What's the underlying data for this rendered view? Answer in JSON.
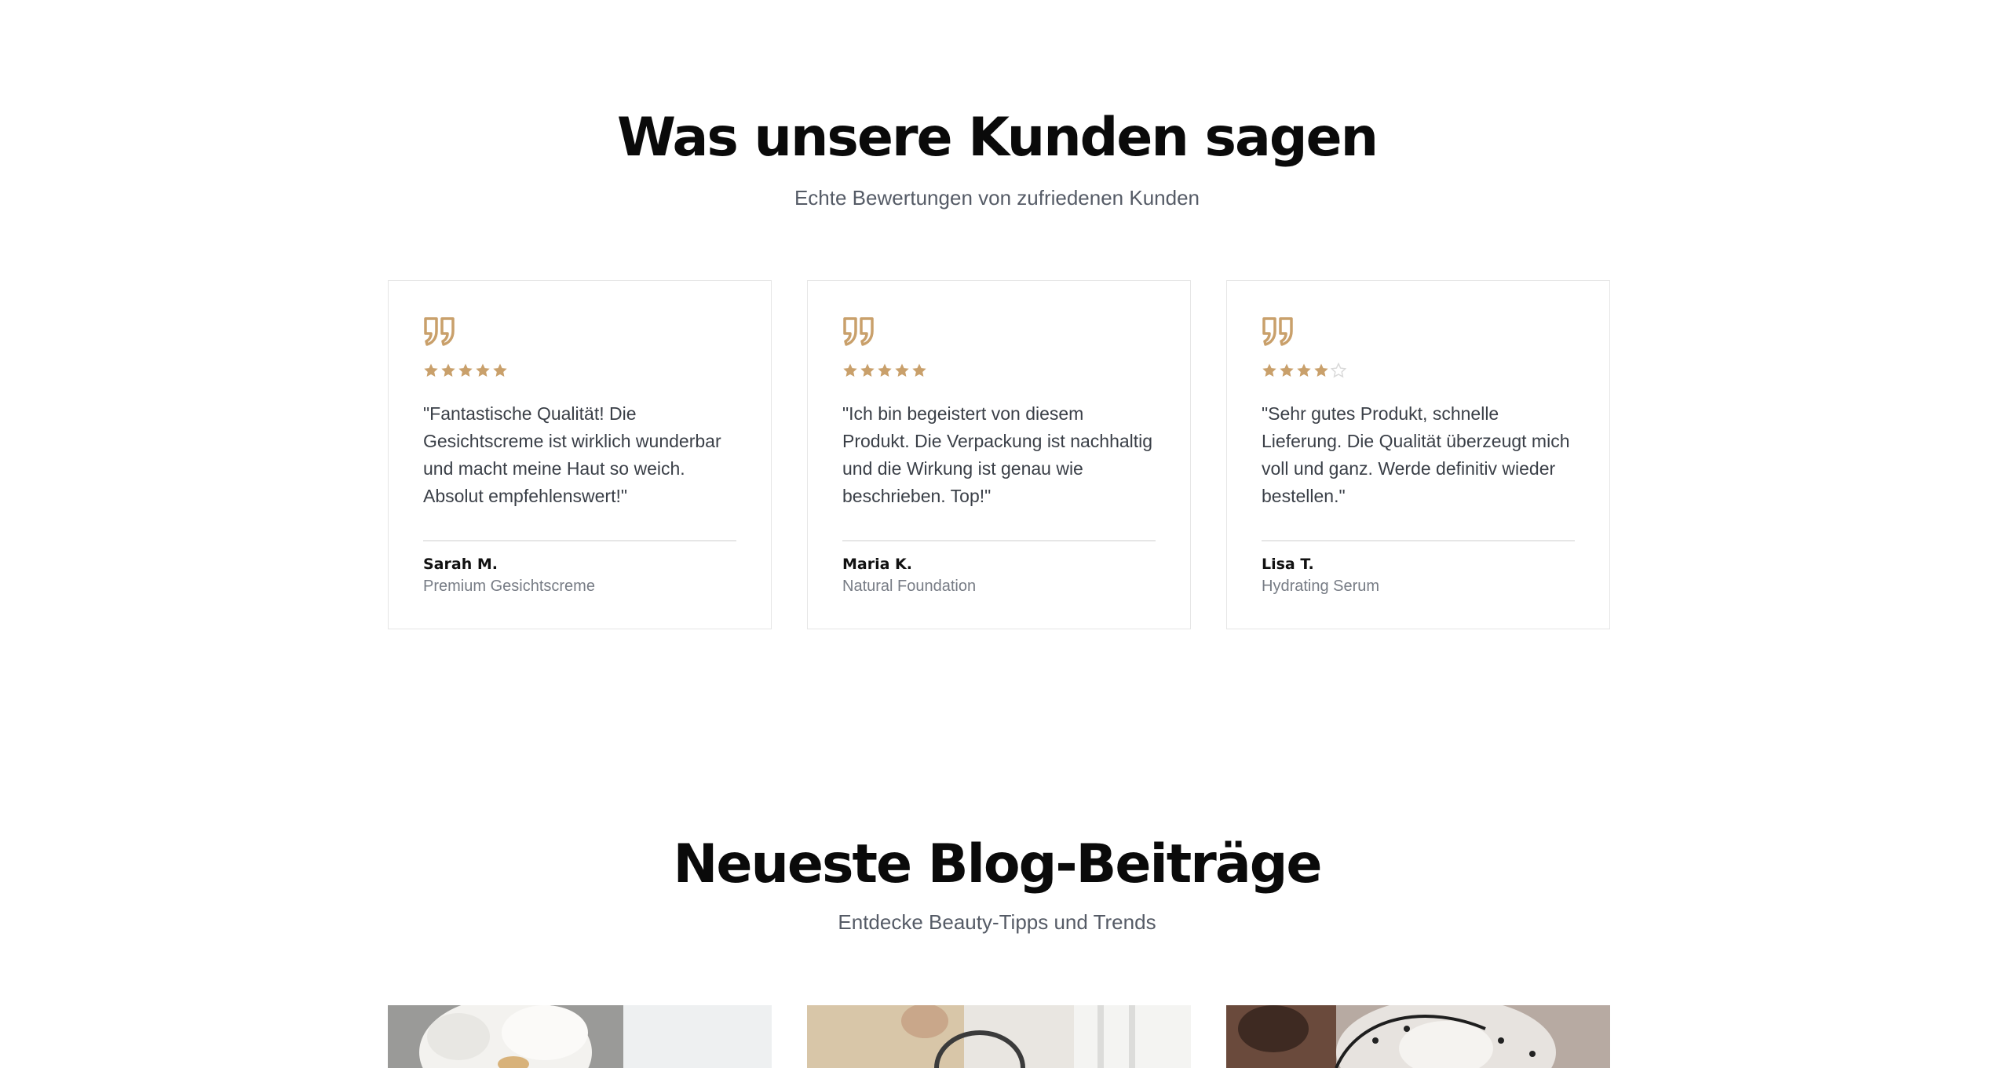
{
  "testimonials": {
    "title": "Was unsere Kunden sagen",
    "subtitle": "Echte Bewertungen von zufriedenen Kunden",
    "accent_color": "#c9a06b",
    "empty_star_color": "#d9d9d9",
    "items": [
      {
        "rating": 5,
        "text": "\"Fantastische Qualität! Die Gesichtscreme ist wirklich wunderbar und macht meine Haut so weich. Absolut empfehlenswert!\"",
        "author": "Sarah M.",
        "product": "Premium Gesichtscreme"
      },
      {
        "rating": 5,
        "text": "\"Ich bin begeistert von diesem Produkt. Die Verpackung ist nachhaltig und die Wirkung ist genau wie beschrieben. Top!\"",
        "author": "Maria K.",
        "product": "Natural Foundation"
      },
      {
        "rating": 4,
        "text": "\"Sehr gutes Produkt, schnelle Lieferung. Die Qualität überzeugt mich voll und ganz. Werde definitiv wieder bestellen.\"",
        "author": "Lisa T.",
        "product": "Hydrating Serum"
      }
    ]
  },
  "blog": {
    "title": "Neueste Blog-Beiträge",
    "subtitle": "Entdecke Beauty-Tipps und Trends"
  }
}
